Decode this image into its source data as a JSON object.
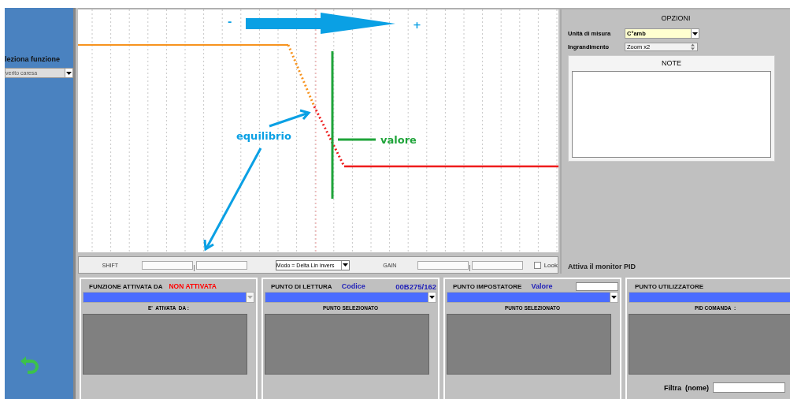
{
  "sidebar": {
    "label": "leziona funzione",
    "dropdown": {
      "value": "verito caresa"
    }
  },
  "chart": {
    "minus_label": "-",
    "plus_label": "+",
    "equilibrium_label": "equilibrio",
    "value_label": "valore"
  },
  "controls": {
    "shift": {
      "label": "SHIFT",
      "level": 0.5
    },
    "mode": {
      "value": "Modo = Delta Lin invers"
    },
    "gain": {
      "label": "GAIN",
      "level": 0.5
    },
    "look": {
      "label": "Look",
      "checked": false
    }
  },
  "options": {
    "title": "OPZIONI",
    "unit": {
      "label": "Unità di misura",
      "value": "C°amb"
    },
    "zoom": {
      "label": "Ingrandimento",
      "value": "Zoom x2"
    },
    "notes_title": "NOTE",
    "monitor_label": "Attiva il monitor PID"
  },
  "panels": [
    {
      "title": "FUNZIONE ATTIVATA DA",
      "status": "NON ATTIVATA",
      "dropdown_disabled": true,
      "caption": "E'  ATIVATA  DA :"
    },
    {
      "title": "PUNTO DI LETTURA",
      "code_label": "Codice",
      "code": "00B275/162",
      "dropdown_disabled": false,
      "caption": "PUNTO SELEZIONATO"
    },
    {
      "title": "PUNTO IMPOSTATORE",
      "value_label": "Valore",
      "has_value_field": true,
      "dropdown_disabled": false,
      "caption": "PUNTO SELEZIONATO"
    },
    {
      "title": "PUNTO UTILIZZATORE",
      "caption": "PID COMANDA  :",
      "filter_label": "Filtra  (nome)"
    }
  ]
}
